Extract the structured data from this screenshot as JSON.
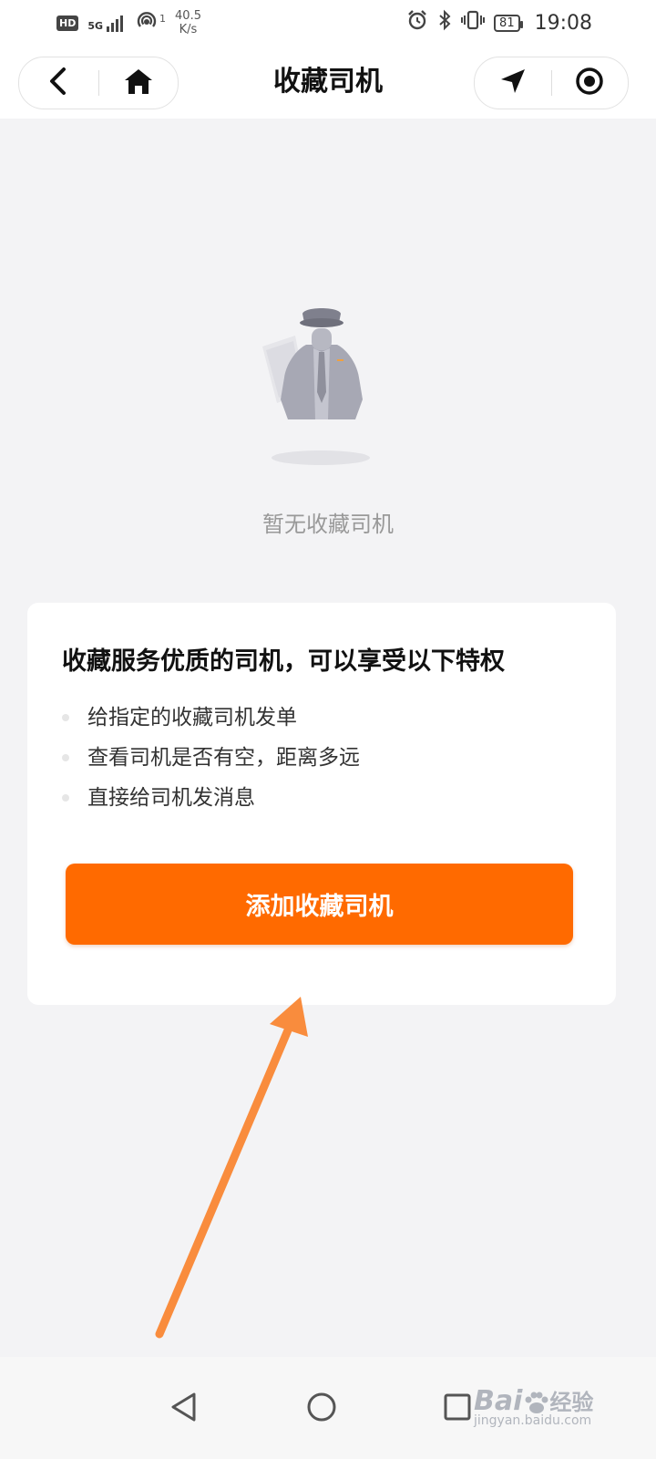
{
  "status_bar": {
    "hd": "HD",
    "network": "5G",
    "speed_value": "40.5",
    "speed_unit": "K/s",
    "sim_index": "1",
    "battery": "81",
    "time": "19:08"
  },
  "header": {
    "title": "收藏司机",
    "icons": [
      "back-icon",
      "home-icon",
      "location-arrow-icon",
      "target-icon"
    ]
  },
  "empty_state": {
    "icon": "driver-icon",
    "message": "暂无收藏司机"
  },
  "benefits_card": {
    "title": "收藏服务优质的司机，可以享受以下特权",
    "items": [
      "给指定的收藏司机发单",
      "查看司机是否有空，距离多远",
      "直接给司机发消息"
    ],
    "button_label": "添加收藏司机",
    "button_color": "#ff6a00"
  },
  "annotation": {
    "arrow_color": "#f98c3d"
  },
  "nav_bar": {
    "icons": [
      "back-triangle-icon",
      "home-circle-icon",
      "recent-square-icon"
    ]
  },
  "watermark": {
    "text_main_1": "Bai",
    "text_main_2": "经验",
    "text_sub": "jingyan.baidu.com"
  }
}
